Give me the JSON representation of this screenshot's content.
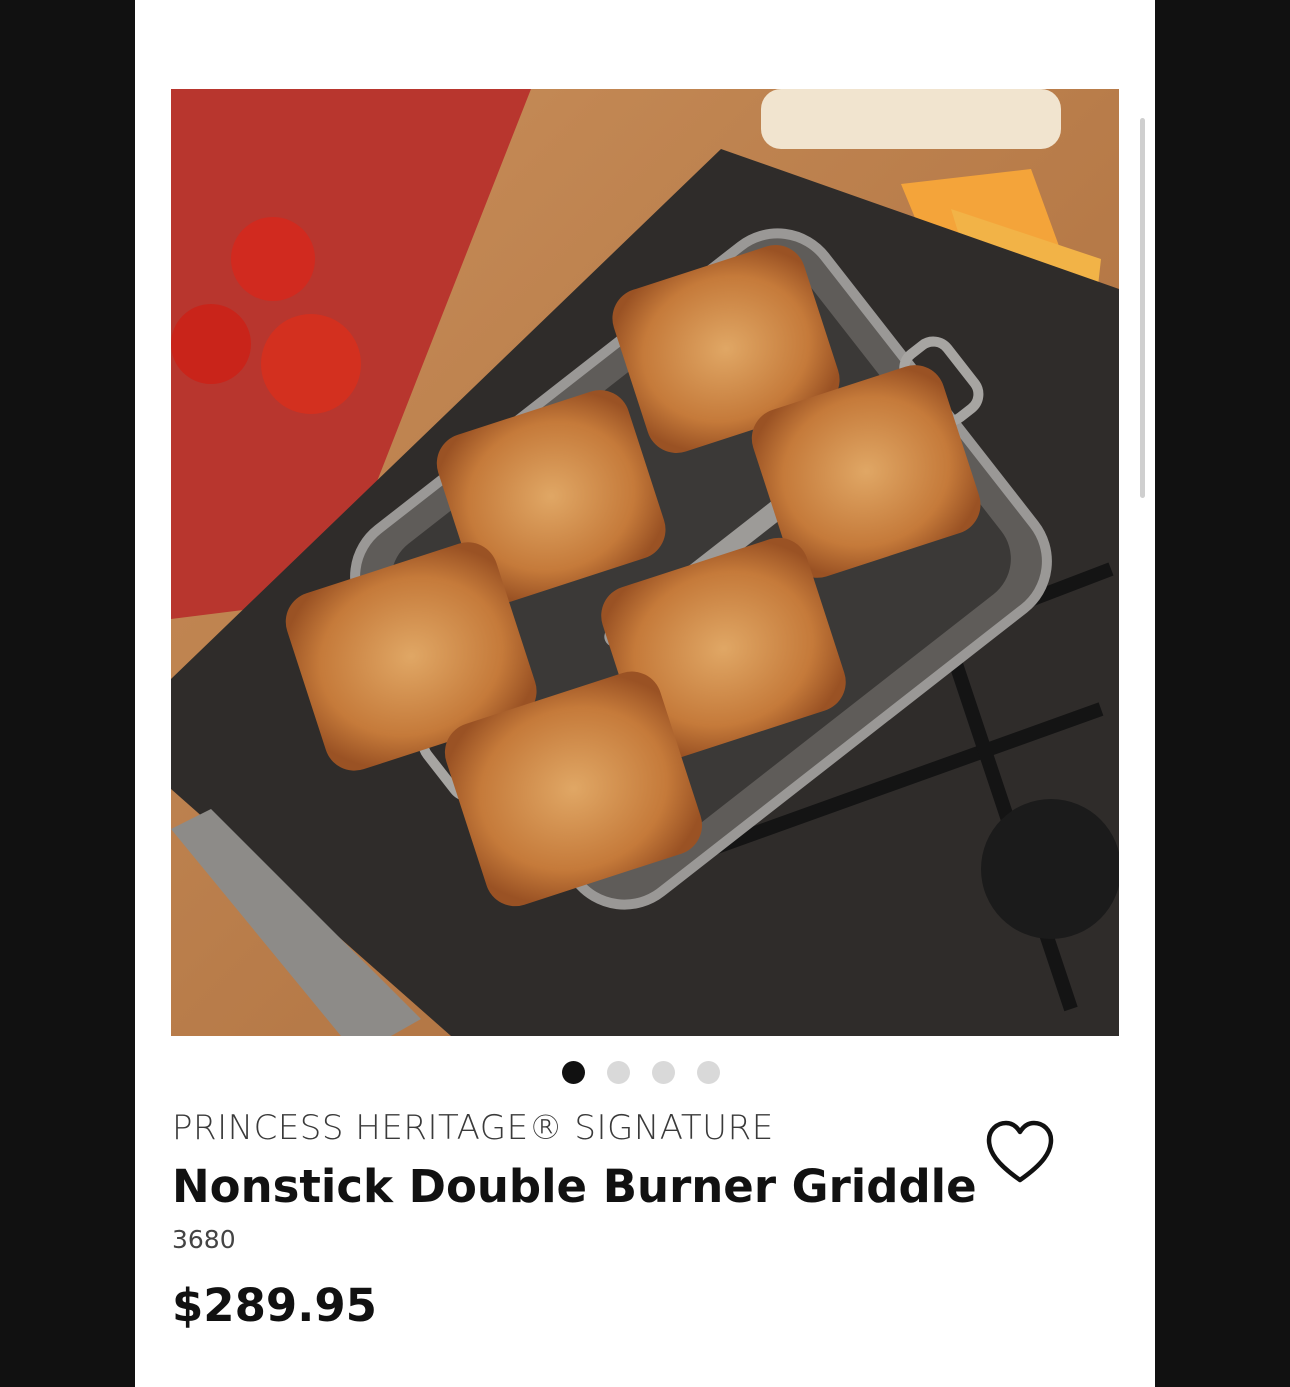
{
  "product": {
    "brand": "PRINCESS HERITAGE® SIGNATURE",
    "name": "Nonstick Double Burner Griddle",
    "sku": "3680",
    "price": "$289.95"
  },
  "carousel": {
    "total_images": 4,
    "active_index": 0
  },
  "icons": {
    "wishlist": "heart-outline-icon"
  },
  "colors": {
    "page_bg": "#ffffff",
    "frame_bg": "#111111",
    "text_primary": "#111111",
    "dot_active": "#111111",
    "dot_inactive": "#d9d9d9"
  }
}
